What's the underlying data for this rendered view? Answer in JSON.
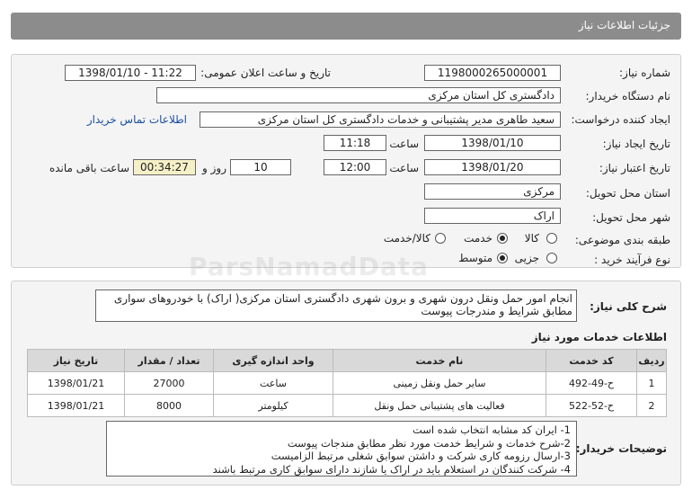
{
  "page_title": "جزئیات اطلاعات نیاز",
  "fields": {
    "need_number_label": "شماره نیاز:",
    "need_number": "1198000265000001",
    "announce_label": "تاریخ و ساعت اعلان عمومی:",
    "announce_value": "1398/01/10 - 11:22",
    "buyer_org_label": "نام دستگاه خریدار:",
    "buyer_org": "دادگستری کل استان مرکزی",
    "requester_label": "ایجاد کننده درخواست:",
    "requester": "سعید طاهری مدیر پشتیبانی و خدمات دادگستری کل استان مرکزی",
    "contact_link": "اطلاعات تماس خریدار",
    "create_date_label": "تاریخ ایجاد نیاز:",
    "create_date": "1398/01/10",
    "time_label": "ساعت",
    "create_time": "11:18",
    "validity_label": "تاریخ اعتبار نیاز:",
    "validity_date": "1398/01/20",
    "validity_time": "12:00",
    "days_value": "10",
    "days_label": "روز و",
    "remaining_time": "00:34:27",
    "remaining_label": "ساعت باقی مانده",
    "province_label": "استان محل تحویل:",
    "province": "مرکزی",
    "city_label": "شهر محل تحویل:",
    "city": "اراک",
    "category_label": "طبقه بندی موضوعی:",
    "category_options": [
      "کالا",
      "خدمت",
      "کالا/خدمت"
    ],
    "category_selected": "خدمت",
    "process_label": "نوع فرآیند خرید :",
    "process_options": [
      "جزیی",
      "متوسط"
    ],
    "process_selected": "متوسط"
  },
  "summary_label": "شرح کلی نیاز:",
  "summary_text": "انجام امور حمل ونقل درون شهری و برون شهری دادگستری استان مرکزی( اراک) با خودروهای سواری مطابق شرایط و مندرجات پیوست",
  "services_title": "اطلاعات خدمات مورد نیاز",
  "table": {
    "headers": [
      "ردیف",
      "کد خدمت",
      "نام خدمت",
      "واحد اندازه گیری",
      "تعداد / مقدار",
      "تاریخ نیاز"
    ],
    "rows": [
      [
        "1",
        "ح-49-492",
        "سایر حمل ونقل زمینی",
        "ساعت",
        "27000",
        "1398/01/21"
      ],
      [
        "2",
        "ح-52-522",
        "فعالیت های پشتیبانی حمل ونقل",
        "کیلومتر",
        "8000",
        "1398/01/21"
      ]
    ]
  },
  "buyer_notes_label": "توضیحات خریدار:",
  "buyer_notes": [
    "1- ایران کد مشابه انتخاب شده است",
    "2-شرح خدمات و شرایط خدمت مورد نظر مطابق مندجات پیوست",
    "3-ارسال رزومه کاری شرکت  و داشتن سوابق شغلی مرتبط  الزامیست",
    "4- شرکت کنندگان در استعلام باید در اراک یا شازند دارای سوابق کاری مرتبط باشند"
  ],
  "watermark": "ParsNamadData"
}
